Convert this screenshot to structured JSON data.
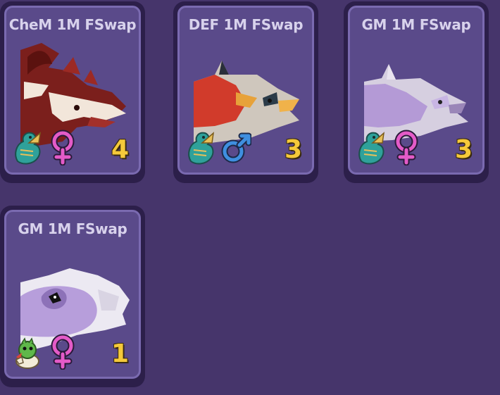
{
  "pets": [
    {
      "name": "CheM 1M FSwap",
      "count": "4",
      "creature_icon": "dragon-icon",
      "gender": "female",
      "gender_icon": "female-symbol-icon"
    },
    {
      "name": "DEF 1M FSwap",
      "count": "3",
      "creature_icon": "dragon-icon",
      "gender": "male",
      "gender_icon": "male-symbol-icon"
    },
    {
      "name": "GM 1M FSwap",
      "count": "3",
      "creature_icon": "dragon-icon",
      "gender": "female",
      "gender_icon": "female-symbol-icon"
    },
    {
      "name": "GM 1M FSwap",
      "count": "1",
      "creature_icon": "hatchling-egg-icon",
      "gender": "female",
      "gender_icon": "female-symbol-icon"
    }
  ],
  "colors": {
    "background": "#46356b",
    "card": "#5a4a8a",
    "count": "#f5c93a",
    "female": "#e45bc8",
    "male": "#3f8fe0"
  }
}
